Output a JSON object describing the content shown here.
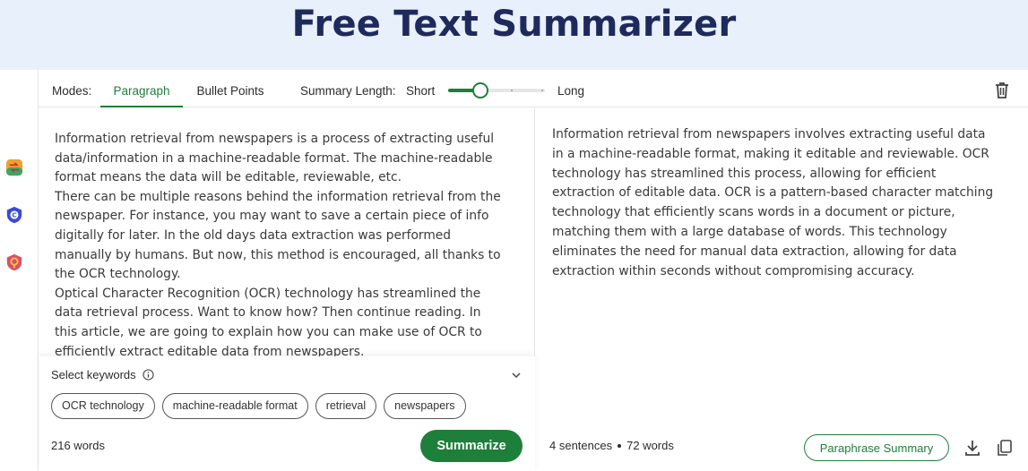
{
  "header": {
    "title": "Free Text Summarizer"
  },
  "toolbar": {
    "modes_label": "Modes:",
    "tabs": [
      {
        "label": "Paragraph",
        "active": true
      },
      {
        "label": "Bullet Points",
        "active": false
      }
    ],
    "summary_length_label": "Summary Length:",
    "short_label": "Short",
    "long_label": "Long",
    "summary_length_level": 0.33
  },
  "input": {
    "paragraphs": [
      "Information retrieval from newspapers is a process of extracting useful data/information in a machine-readable format. The machine-readable format means the data will be editable, reviewable, etc.",
      "There can be multiple reasons behind the information retrieval from the newspaper. For instance, you may want to save a certain piece of info digitally for later. In the old days data extraction was performed manually by humans. But now, this method is encouraged, all thanks to the OCR technology.",
      "Optical Character Recognition (OCR) technology has streamlined the data retrieval process. Want to know how? Then continue reading. In this article, we are going to explain how you can make use of OCR to efficiently extract editable data from newspapers."
    ],
    "word_count": "216 words"
  },
  "keywords": {
    "title": "Select keywords",
    "items": [
      "OCR technology",
      "machine-readable format",
      "retrieval",
      "newspapers"
    ]
  },
  "actions": {
    "summarize_label": "Summarize",
    "paraphrase_label": "Paraphrase Summary"
  },
  "output": {
    "text": "Information retrieval from newspapers involves extracting useful data in a machine-readable format, making it editable and reviewable. OCR technology has streamlined this process, allowing for efficient extraction of editable data. OCR is a pattern-based character matching technology that efficiently scans words in a document or picture, matching them with a large database of words. This technology eliminates the need for manual data extraction, allowing for data extraction within seconds without compromising accuracy.",
    "sentences": "4 sentences",
    "words": "72 words"
  },
  "colors": {
    "accent": "#1e7f3a",
    "title": "#1f2a5c",
    "hero_bg": "#e7f0fb"
  }
}
